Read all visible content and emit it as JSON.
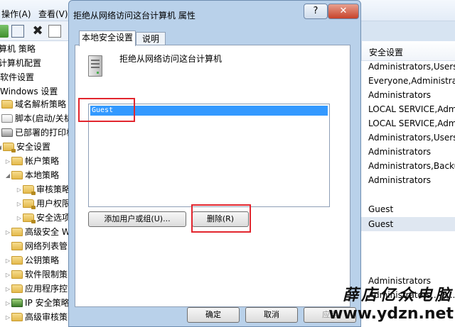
{
  "menubar": {
    "action": "操作(A)",
    "view": "查看(V)"
  },
  "tree": {
    "items": [
      "算机 策略",
      "计算机配置",
      "软件设置",
      "Windows 设置",
      "域名解析策略",
      "脚本(启动/关机",
      "已部署的打印机",
      "安全设置",
      "帐户策略",
      "本地策略",
      "审核策略",
      "用户权限",
      "安全选项",
      "高级安全 W",
      "网络列表管",
      "公钥策略",
      "软件限制策",
      "应用程序控",
      "IP 安全策略",
      "高级审核策"
    ]
  },
  "right_pane": {
    "header": "安全设置",
    "rows": [
      "Administrators,Users",
      "Everyone,Administrat...",
      "Administrators",
      "LOCAL SERVICE,Admi...",
      "LOCAL SERVICE,Admi...",
      "Administrators,Users,...",
      "Administrators",
      "Administrators,Backu...",
      "Administrators",
      "Guest",
      "Guest",
      "Administrators",
      "Administrators,...E..."
    ]
  },
  "dialog": {
    "title": "拒绝从网络访问这台计算机 属性",
    "help": "?",
    "close": "✕",
    "tabs": {
      "local": "本地安全设置",
      "explain": "说明"
    },
    "policy_name": "拒绝从网络访问这台计算机",
    "list": [
      "Guest"
    ],
    "add_button": "添加用户或组(U)...",
    "remove_button": "删除(R)",
    "ok": "确定",
    "cancel": "取消",
    "apply": "应用"
  },
  "watermark": {
    "line1": "薛店亿众电脑",
    "line2": "www.ydzn.net"
  }
}
